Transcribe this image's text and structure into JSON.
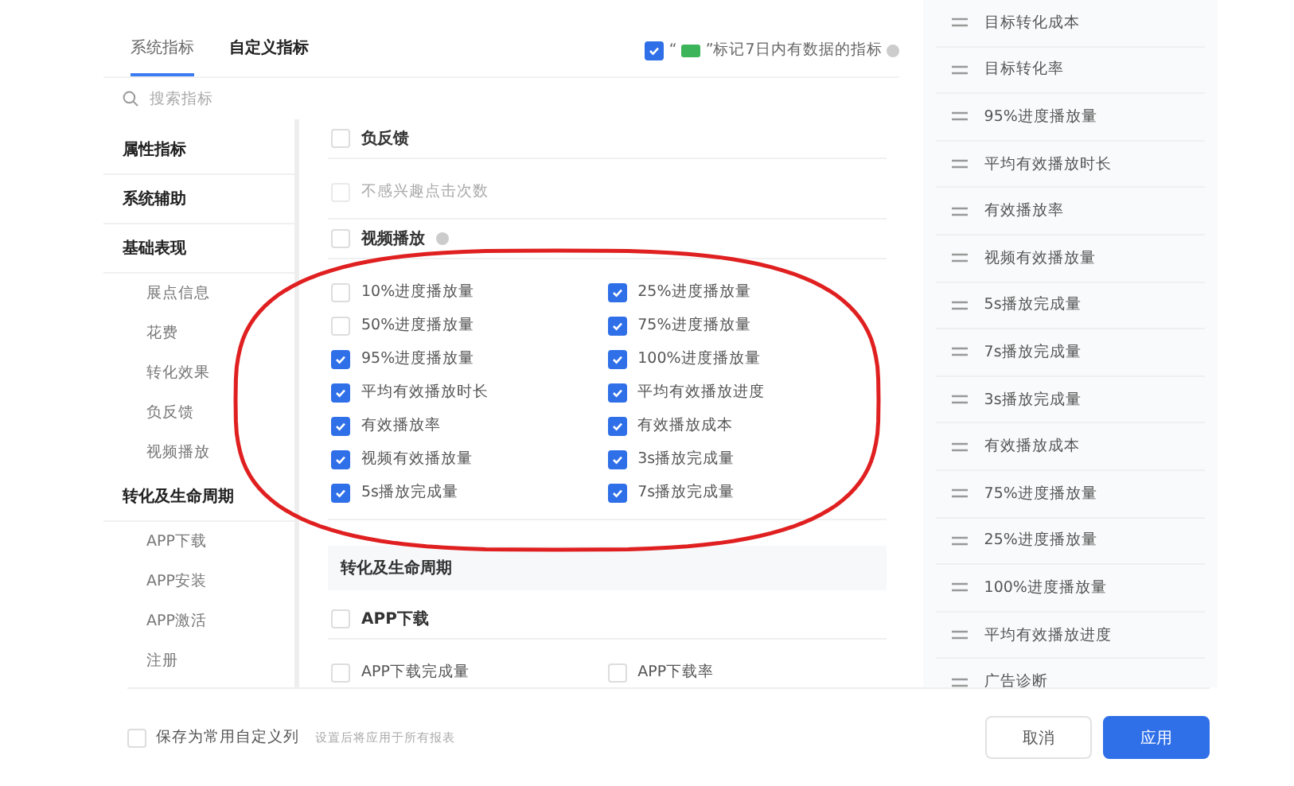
{
  "tabs": [
    {
      "label": "系统指标",
      "selected": true
    },
    {
      "label": "自定义指标",
      "selected": false
    }
  ],
  "mark_option": {
    "checked": true,
    "open_quote": "“",
    "label": "”标记7日内有数据的指标"
  },
  "search": {
    "placeholder": "搜索指标"
  },
  "nav": [
    {
      "label": "属性指标"
    },
    {
      "label": "系统辅助"
    },
    {
      "label": "基础表现",
      "children": [
        {
          "label": "展点信息"
        },
        {
          "label": "花费"
        },
        {
          "label": "转化效果"
        },
        {
          "label": "负反馈"
        },
        {
          "label": "视频播放"
        }
      ]
    },
    {
      "label": "转化及生命周期",
      "children": [
        {
          "label": "APP下载"
        },
        {
          "label": "APP安装"
        },
        {
          "label": "APP激活"
        },
        {
          "label": "注册"
        }
      ]
    }
  ],
  "blocks": [
    {
      "kind": "group",
      "label": "负反馈",
      "checked": false,
      "help": false,
      "items": [
        {
          "label": "不感兴趣点击次数",
          "checked": false,
          "disabled": true
        }
      ]
    },
    {
      "kind": "group",
      "label": "视频播放",
      "checked": false,
      "help": true,
      "items": [
        {
          "label": "10%进度播放量",
          "checked": false,
          "disabled": false
        },
        {
          "label": "25%进度播放量",
          "checked": true,
          "disabled": false
        },
        {
          "label": "50%进度播放量",
          "checked": false,
          "disabled": false
        },
        {
          "label": "75%进度播放量",
          "checked": true,
          "disabled": false
        },
        {
          "label": "95%进度播放量",
          "checked": true,
          "disabled": false
        },
        {
          "label": "100%进度播放量",
          "checked": true,
          "disabled": false
        },
        {
          "label": "平均有效播放时长",
          "checked": true,
          "disabled": false
        },
        {
          "label": "平均有效播放进度",
          "checked": true,
          "disabled": false
        },
        {
          "label": "有效播放率",
          "checked": true,
          "disabled": false
        },
        {
          "label": "有效播放成本",
          "checked": true,
          "disabled": false
        },
        {
          "label": "视频有效播放量",
          "checked": true,
          "disabled": false
        },
        {
          "label": "3s播放完成量",
          "checked": true,
          "disabled": false
        },
        {
          "label": "5s播放完成量",
          "checked": true,
          "disabled": false
        },
        {
          "label": "7s播放完成量",
          "checked": true,
          "disabled": false
        }
      ]
    },
    {
      "kind": "section",
      "label": "转化及生命周期"
    },
    {
      "kind": "group",
      "label": "APP下载",
      "checked": false,
      "help": false,
      "items": [
        {
          "label": "APP下载完成量",
          "checked": false,
          "disabled": false
        },
        {
          "label": "APP下载率",
          "checked": false,
          "disabled": false
        }
      ]
    }
  ],
  "selected_columns": [
    "目标转化成本",
    "目标转化率",
    "95%进度播放量",
    "平均有效播放时长",
    "有效播放率",
    "视频有效播放量",
    "5s播放完成量",
    "7s播放完成量",
    "3s播放完成量",
    "有效播放成本",
    "75%进度播放量",
    "25%进度播放量",
    "100%进度播放量",
    "平均有效播放进度",
    "广告诊断"
  ],
  "footer": {
    "save_option": {
      "label": "保存为常用自定义列",
      "checked": false
    },
    "hint": "设置后将应用于所有报表",
    "buttons": [
      {
        "label": "取消",
        "kind": "secondary"
      },
      {
        "label": "应用",
        "kind": "primary"
      }
    ]
  }
}
